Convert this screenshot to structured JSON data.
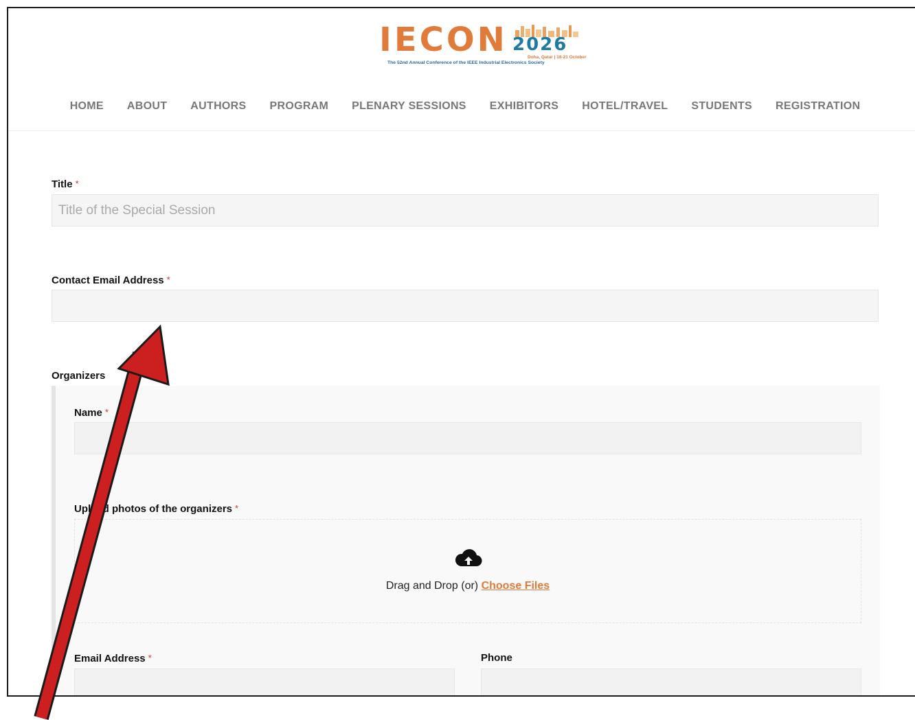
{
  "logo": {
    "word": "IECON",
    "year": "2026",
    "location": "Doha, Qatar | 18-21 October",
    "tagline": "The 52nd Annual Conference of the IEEE Industrial Electronics Society"
  },
  "nav": {
    "items": [
      "HOME",
      "ABOUT",
      "AUTHORS",
      "PROGRAM",
      "PLENARY SESSIONS",
      "EXHIBITORS",
      "HOTEL/TRAVEL",
      "STUDENTS",
      "REGISTRATION"
    ]
  },
  "form": {
    "required_mark": "*",
    "title": {
      "label": "Title",
      "placeholder": "Title of the Special Session",
      "value": ""
    },
    "contact_email": {
      "label": "Contact Email Address",
      "value": ""
    },
    "organizers": {
      "label": "Organizers",
      "name": {
        "label": "Name",
        "value": ""
      },
      "photos": {
        "label": "Upload photos of the organizers",
        "drop_text": "Drag and Drop (or)",
        "choose_files": "Choose Files"
      },
      "email": {
        "label": "Email Address",
        "value": ""
      },
      "phone": {
        "label": "Phone",
        "value": ""
      }
    }
  },
  "colors": {
    "brand_orange": "#e07b39",
    "brand_blue": "#1f7aa3",
    "required_red": "#d0342c",
    "annotation_arrow": "#cc1f1f"
  },
  "icons": [
    "cloud-upload-icon",
    "annotation-arrow"
  ]
}
